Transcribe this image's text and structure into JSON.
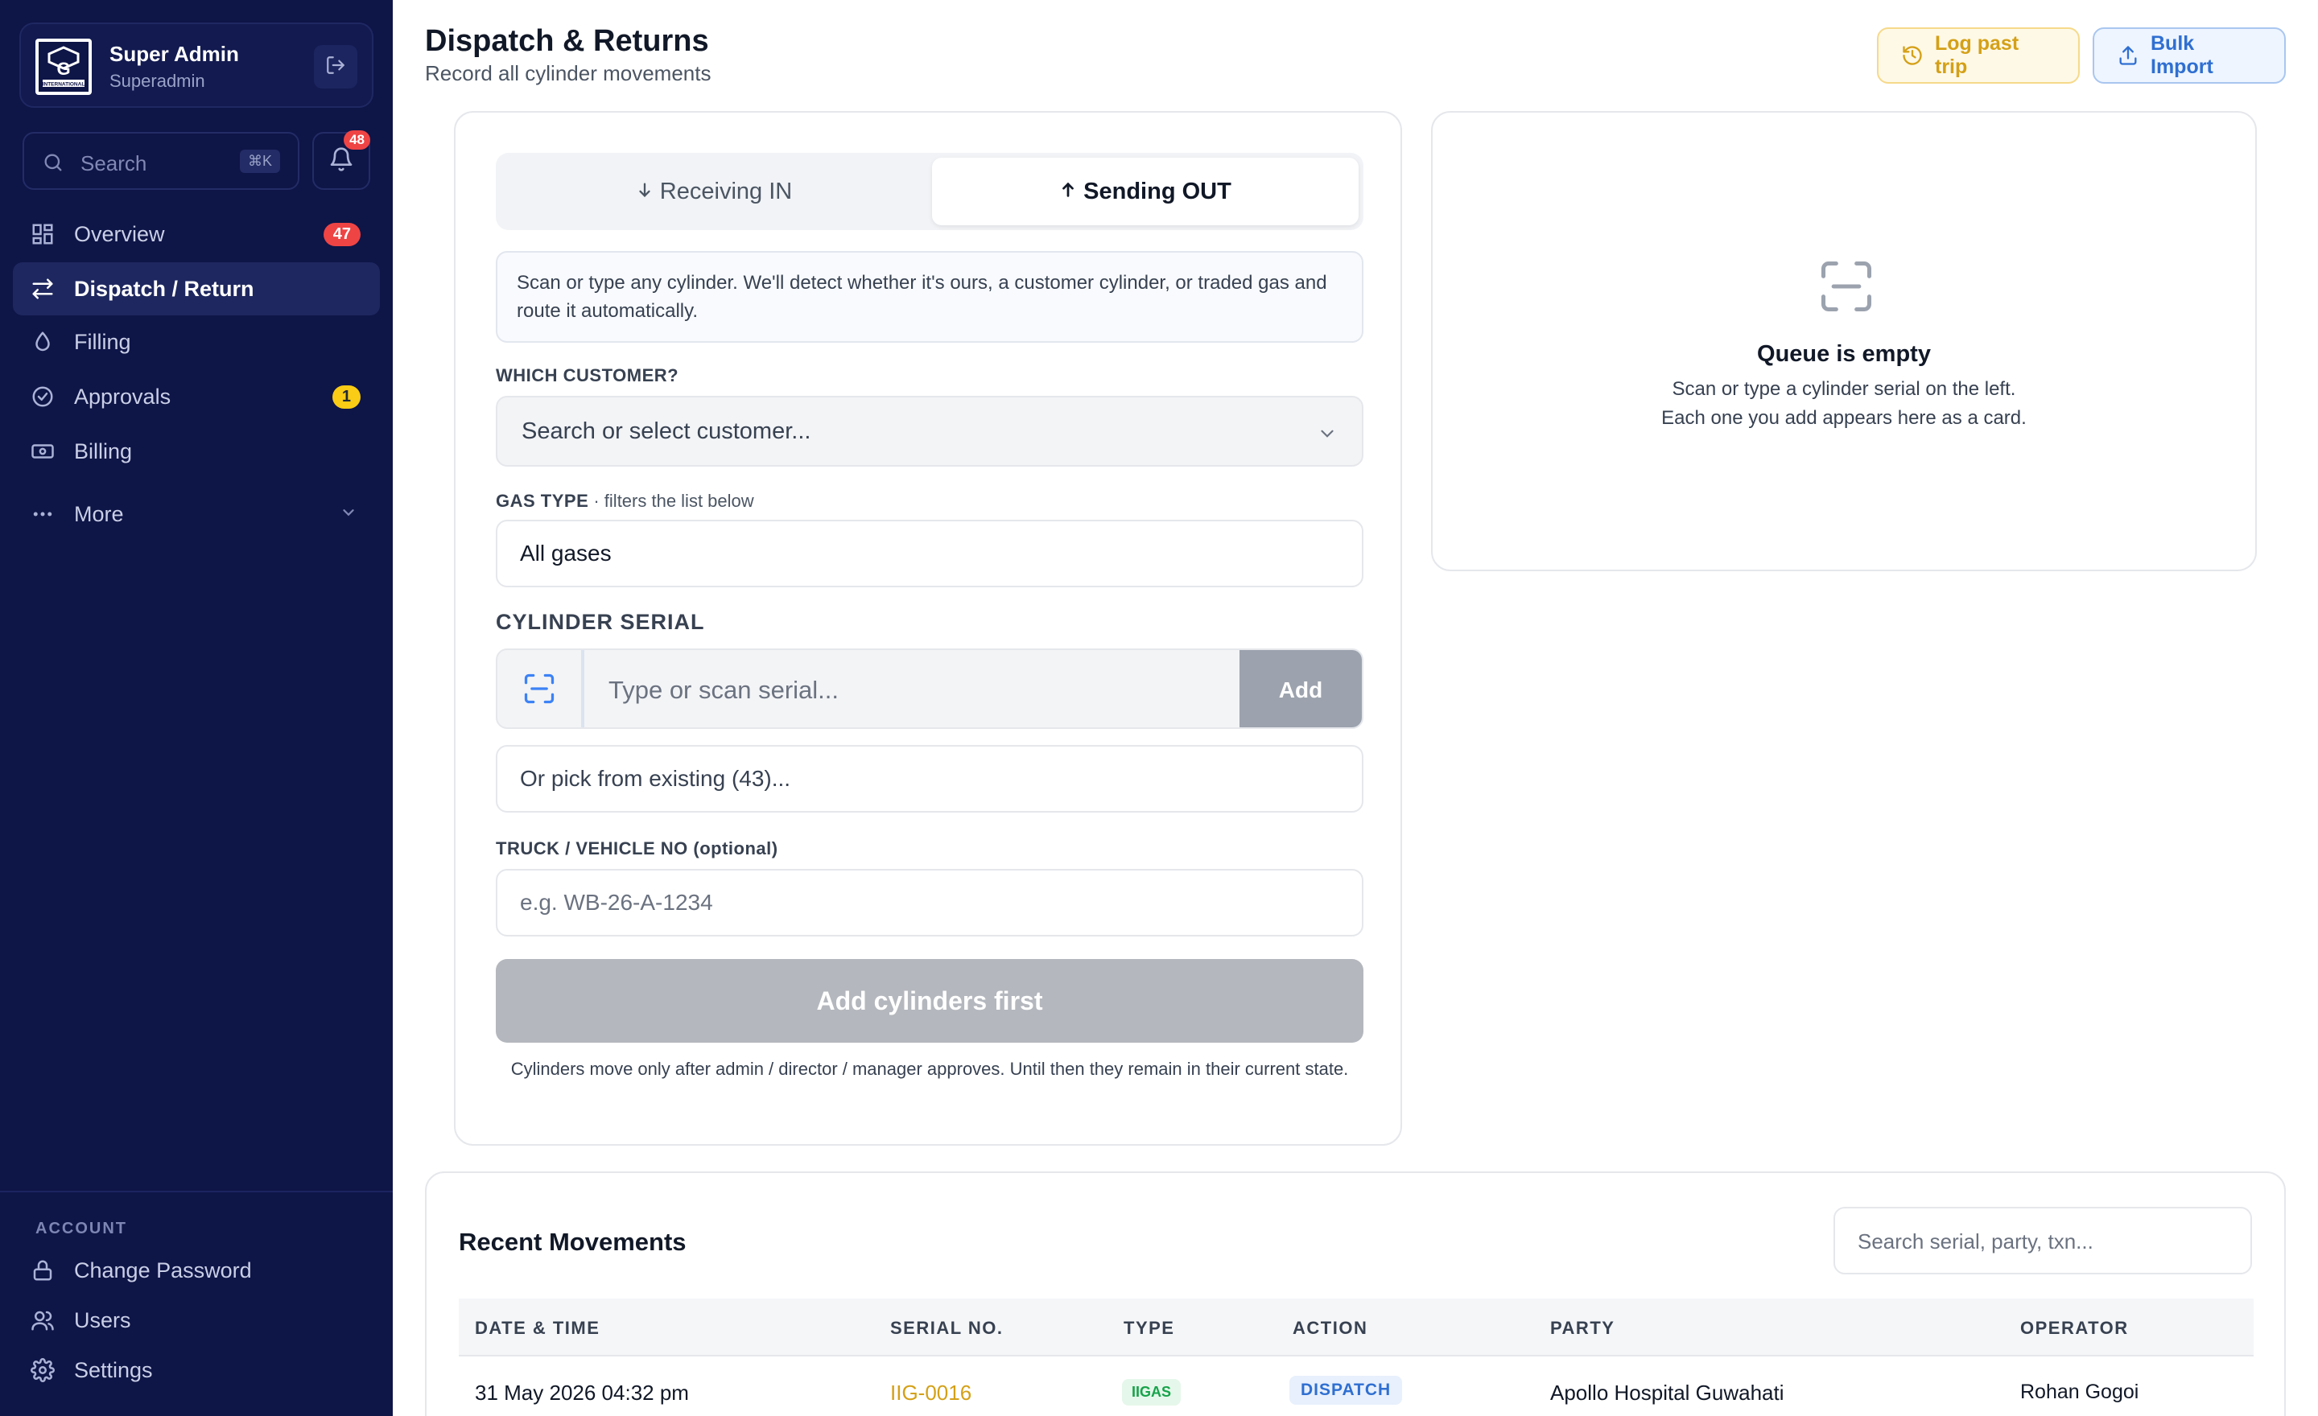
{
  "sidebar": {
    "profile": {
      "name": "Super Admin",
      "role": "Superadmin",
      "logo_text": "G",
      "logo_caption": "INTERNATIONAL"
    },
    "search": {
      "label": "Search",
      "shortcut": "⌘K"
    },
    "notifications": {
      "count": "48"
    },
    "nav": [
      {
        "label": "Overview",
        "icon": "grid-icon",
        "badge": "47",
        "badge_color": "#ef4444"
      },
      {
        "label": "Dispatch / Return",
        "icon": "swap-arrows-icon",
        "active": true
      },
      {
        "label": "Filling",
        "icon": "droplet-icon"
      },
      {
        "label": "Approvals",
        "icon": "check-circle-icon",
        "badge": "1",
        "badge_color": "#facc15"
      },
      {
        "label": "Billing",
        "icon": "banknote-icon"
      },
      {
        "label": "More",
        "icon": "more-dots-icon"
      }
    ],
    "account_section": {
      "label": "ACCOUNT",
      "items": [
        {
          "label": "Change Password",
          "icon": "lock-icon"
        },
        {
          "label": "Users",
          "icon": "users-icon"
        },
        {
          "label": "Settings",
          "icon": "gear-icon"
        }
      ]
    }
  },
  "header": {
    "title": "Dispatch & Returns",
    "subtitle": "Record all cylinder movements",
    "log_past_trip": "Log past trip",
    "bulk_import": "Bulk Import"
  },
  "form": {
    "mode_in": "Receiving IN",
    "mode_out": "Sending OUT",
    "active_mode": "Sending OUT",
    "info": "Scan or type any cylinder. We'll detect whether it's ours, a customer cylinder, or traded gas and route it automatically.",
    "customer_label": "WHICH CUSTOMER?",
    "customer_placeholder": "Search or select customer...",
    "gas_type_label": "GAS TYPE",
    "gas_type_hint": " · filters the list below",
    "gas_type_value": "All gases",
    "serial_label": "CYLINDER SERIAL",
    "serial_placeholder": "Type or scan serial...",
    "serial_add": "Add",
    "pick_existing": "Or pick from existing (43)...",
    "vehicle_label": "TRUCK / VEHICLE NO (optional)",
    "vehicle_placeholder": "e.g. WB-26-A-1234",
    "submit": "Add cylinders first",
    "footnote": "Cylinders move only after admin / director / manager approves. Until then they remain in their current state."
  },
  "queue": {
    "title": "Queue is empty",
    "line1": "Scan or type a cylinder serial on the left.",
    "line2": "Each one you add appears here as a card."
  },
  "recent": {
    "title": "Recent Movements",
    "search_placeholder": "Search serial, party, txn...",
    "columns": [
      "DATE & TIME",
      "SERIAL NO.",
      "TYPE",
      "ACTION",
      "PARTY",
      "OPERATOR"
    ],
    "rows": [
      {
        "datetime": "31 May 2026 04:32 pm",
        "serial": "IIG-0016",
        "type": "IIGAS",
        "action": "DISPATCH",
        "party": "Apollo Hospital Guwahati",
        "operator": "Rohan Gogoi"
      }
    ]
  }
}
